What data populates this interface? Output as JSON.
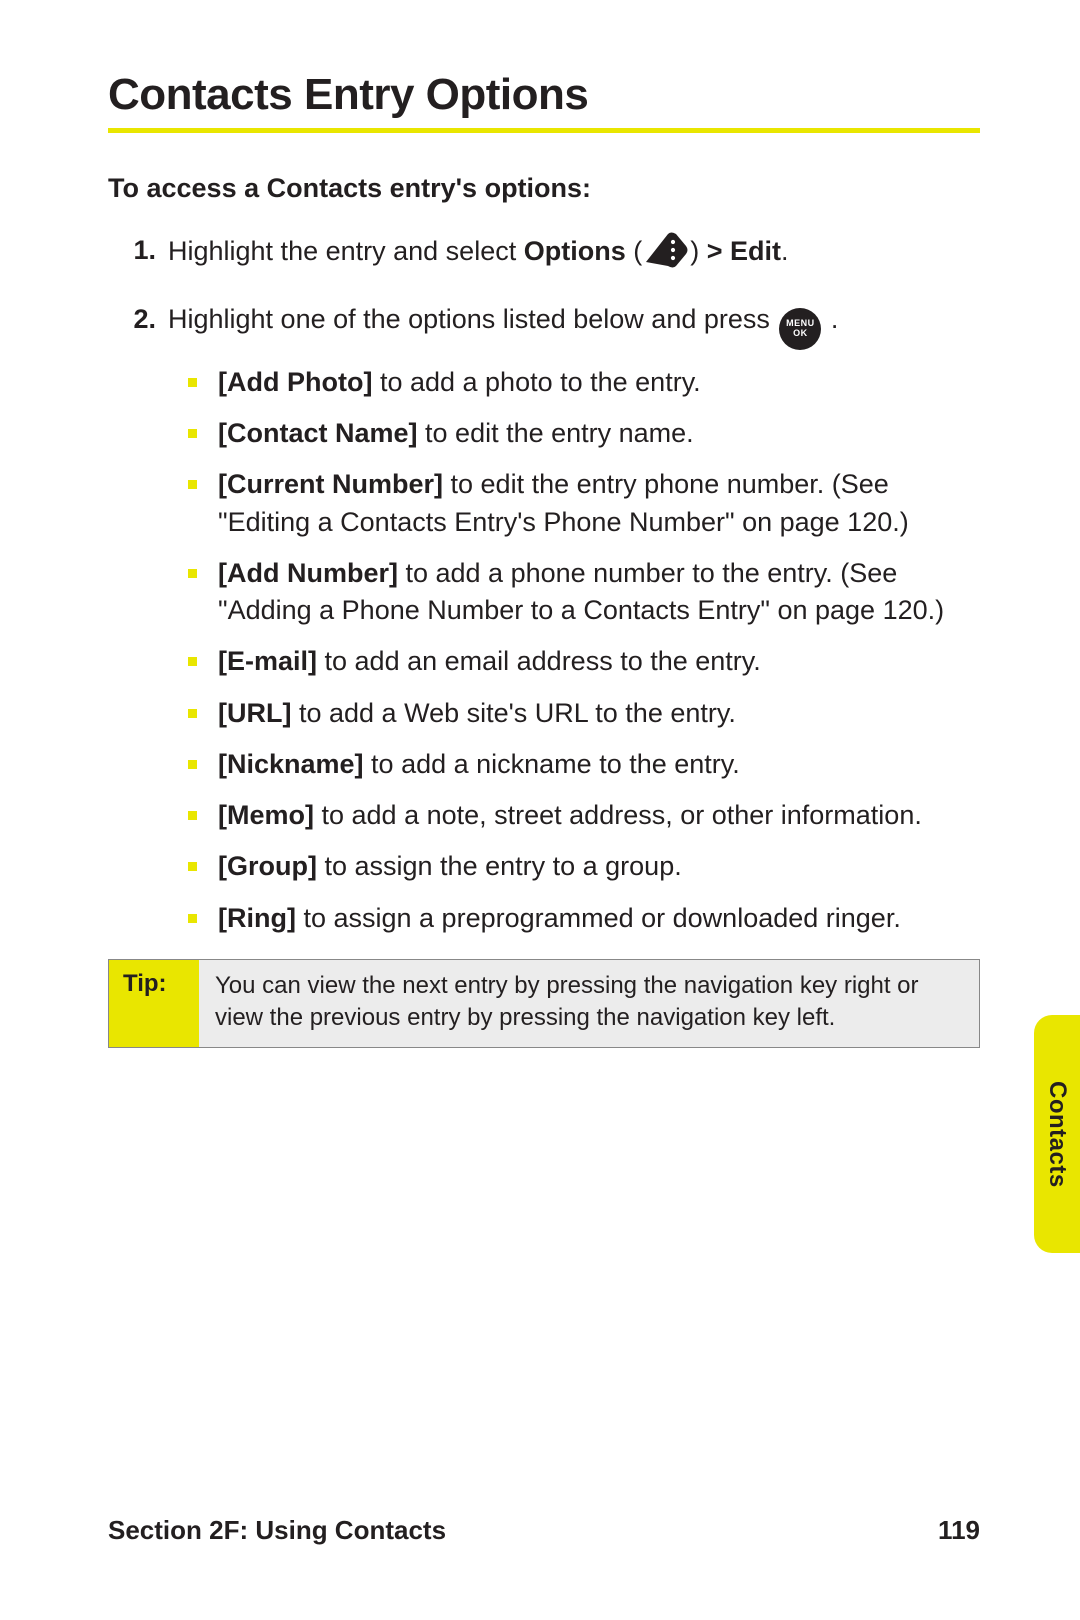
{
  "title": "Contacts Entry Options",
  "subhead": "To access a Contacts entry's options:",
  "steps": {
    "s1": {
      "num": "1.",
      "pre": "Highlight the entry and select ",
      "bold1": "Options",
      "paren_open": " (",
      "paren_close": ") ",
      "bold2": "> Edit",
      "period": "."
    },
    "s2": {
      "num": "2.",
      "pre": "Highlight one of the options listed below and press ",
      "period": " ."
    }
  },
  "icons": {
    "menu_line1": "MENU",
    "menu_line2": "OK"
  },
  "sublist": [
    {
      "bold": "[Add Photo]",
      "rest": " to add a photo to the entry."
    },
    {
      "bold": "[Contact Name]",
      "rest": " to edit the entry name."
    },
    {
      "bold": "[Current Number]",
      "rest": " to edit the entry phone number. (See \"Editing a Contacts Entry's Phone Number\" on page 120.)"
    },
    {
      "bold": "[Add Number]",
      "rest": " to add a phone number to the entry. (See \"Adding a Phone Number to a Contacts Entry\" on page 120.)"
    },
    {
      "bold": "[E-mail]",
      "rest": " to add an email address to the entry."
    },
    {
      "bold": "[URL]",
      "rest": " to add a Web site's URL to the entry."
    },
    {
      "bold": "[Nickname]",
      "rest": " to add a nickname to the entry."
    },
    {
      "bold": "[Memo]",
      "rest": " to add a note, street address, or other information."
    },
    {
      "bold": "[Group]",
      "rest": " to assign the entry to a group."
    },
    {
      "bold": "[Ring]",
      "rest": " to assign a preprogrammed or downloaded ringer."
    }
  ],
  "tip": {
    "label": "Tip:",
    "body": "You can view the next entry by pressing the navigation key right or view the previous entry by pressing the navigation key left."
  },
  "side_tab": "Contacts",
  "footer": {
    "section": "Section 2F: Using Contacts",
    "page": "119"
  }
}
